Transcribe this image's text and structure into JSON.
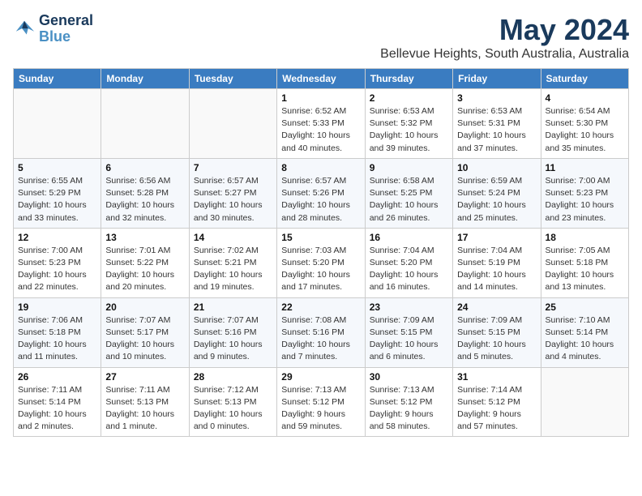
{
  "header": {
    "logo": {
      "line1": "General",
      "line2": "Blue"
    },
    "month": "May 2024",
    "location": "Bellevue Heights, South Australia, Australia"
  },
  "weekdays": [
    "Sunday",
    "Monday",
    "Tuesday",
    "Wednesday",
    "Thursday",
    "Friday",
    "Saturday"
  ],
  "weeks": [
    [
      {
        "day": "",
        "info": ""
      },
      {
        "day": "",
        "info": ""
      },
      {
        "day": "",
        "info": ""
      },
      {
        "day": "1",
        "info": "Sunrise: 6:52 AM\nSunset: 5:33 PM\nDaylight: 10 hours\nand 40 minutes."
      },
      {
        "day": "2",
        "info": "Sunrise: 6:53 AM\nSunset: 5:32 PM\nDaylight: 10 hours\nand 39 minutes."
      },
      {
        "day": "3",
        "info": "Sunrise: 6:53 AM\nSunset: 5:31 PM\nDaylight: 10 hours\nand 37 minutes."
      },
      {
        "day": "4",
        "info": "Sunrise: 6:54 AM\nSunset: 5:30 PM\nDaylight: 10 hours\nand 35 minutes."
      }
    ],
    [
      {
        "day": "5",
        "info": "Sunrise: 6:55 AM\nSunset: 5:29 PM\nDaylight: 10 hours\nand 33 minutes."
      },
      {
        "day": "6",
        "info": "Sunrise: 6:56 AM\nSunset: 5:28 PM\nDaylight: 10 hours\nand 32 minutes."
      },
      {
        "day": "7",
        "info": "Sunrise: 6:57 AM\nSunset: 5:27 PM\nDaylight: 10 hours\nand 30 minutes."
      },
      {
        "day": "8",
        "info": "Sunrise: 6:57 AM\nSunset: 5:26 PM\nDaylight: 10 hours\nand 28 minutes."
      },
      {
        "day": "9",
        "info": "Sunrise: 6:58 AM\nSunset: 5:25 PM\nDaylight: 10 hours\nand 26 minutes."
      },
      {
        "day": "10",
        "info": "Sunrise: 6:59 AM\nSunset: 5:24 PM\nDaylight: 10 hours\nand 25 minutes."
      },
      {
        "day": "11",
        "info": "Sunrise: 7:00 AM\nSunset: 5:23 PM\nDaylight: 10 hours\nand 23 minutes."
      }
    ],
    [
      {
        "day": "12",
        "info": "Sunrise: 7:00 AM\nSunset: 5:23 PM\nDaylight: 10 hours\nand 22 minutes."
      },
      {
        "day": "13",
        "info": "Sunrise: 7:01 AM\nSunset: 5:22 PM\nDaylight: 10 hours\nand 20 minutes."
      },
      {
        "day": "14",
        "info": "Sunrise: 7:02 AM\nSunset: 5:21 PM\nDaylight: 10 hours\nand 19 minutes."
      },
      {
        "day": "15",
        "info": "Sunrise: 7:03 AM\nSunset: 5:20 PM\nDaylight: 10 hours\nand 17 minutes."
      },
      {
        "day": "16",
        "info": "Sunrise: 7:04 AM\nSunset: 5:20 PM\nDaylight: 10 hours\nand 16 minutes."
      },
      {
        "day": "17",
        "info": "Sunrise: 7:04 AM\nSunset: 5:19 PM\nDaylight: 10 hours\nand 14 minutes."
      },
      {
        "day": "18",
        "info": "Sunrise: 7:05 AM\nSunset: 5:18 PM\nDaylight: 10 hours\nand 13 minutes."
      }
    ],
    [
      {
        "day": "19",
        "info": "Sunrise: 7:06 AM\nSunset: 5:18 PM\nDaylight: 10 hours\nand 11 minutes."
      },
      {
        "day": "20",
        "info": "Sunrise: 7:07 AM\nSunset: 5:17 PM\nDaylight: 10 hours\nand 10 minutes."
      },
      {
        "day": "21",
        "info": "Sunrise: 7:07 AM\nSunset: 5:16 PM\nDaylight: 10 hours\nand 9 minutes."
      },
      {
        "day": "22",
        "info": "Sunrise: 7:08 AM\nSunset: 5:16 PM\nDaylight: 10 hours\nand 7 minutes."
      },
      {
        "day": "23",
        "info": "Sunrise: 7:09 AM\nSunset: 5:15 PM\nDaylight: 10 hours\nand 6 minutes."
      },
      {
        "day": "24",
        "info": "Sunrise: 7:09 AM\nSunset: 5:15 PM\nDaylight: 10 hours\nand 5 minutes."
      },
      {
        "day": "25",
        "info": "Sunrise: 7:10 AM\nSunset: 5:14 PM\nDaylight: 10 hours\nand 4 minutes."
      }
    ],
    [
      {
        "day": "26",
        "info": "Sunrise: 7:11 AM\nSunset: 5:14 PM\nDaylight: 10 hours\nand 2 minutes."
      },
      {
        "day": "27",
        "info": "Sunrise: 7:11 AM\nSunset: 5:13 PM\nDaylight: 10 hours\nand 1 minute."
      },
      {
        "day": "28",
        "info": "Sunrise: 7:12 AM\nSunset: 5:13 PM\nDaylight: 10 hours\nand 0 minutes."
      },
      {
        "day": "29",
        "info": "Sunrise: 7:13 AM\nSunset: 5:12 PM\nDaylight: 9 hours\nand 59 minutes."
      },
      {
        "day": "30",
        "info": "Sunrise: 7:13 AM\nSunset: 5:12 PM\nDaylight: 9 hours\nand 58 minutes."
      },
      {
        "day": "31",
        "info": "Sunrise: 7:14 AM\nSunset: 5:12 PM\nDaylight: 9 hours\nand 57 minutes."
      },
      {
        "day": "",
        "info": ""
      }
    ]
  ]
}
